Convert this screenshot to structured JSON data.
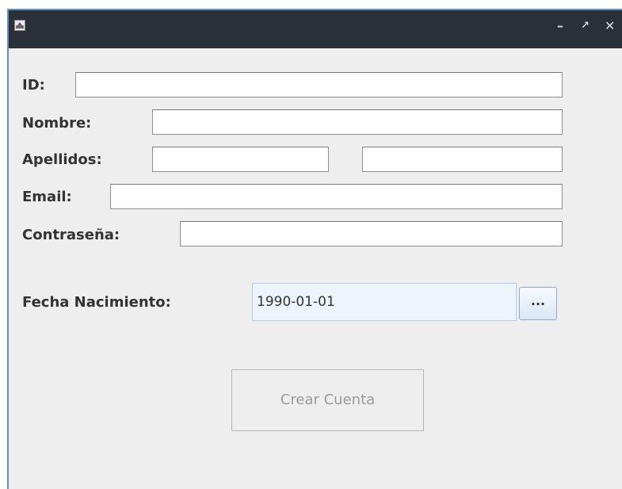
{
  "window": {
    "controls": {
      "minimize": "–",
      "maximize": "↗",
      "close": "✕"
    }
  },
  "form": {
    "id_label": "ID:",
    "id_value": "",
    "nombre_label": "Nombre:",
    "nombre_value": "",
    "apellidos_label": "Apellidos:",
    "apellido1_value": "",
    "apellido2_value": "",
    "email_label": "Email:",
    "email_value": "",
    "password_label": "Contraseña:",
    "password_value": "",
    "fecha_label": "Fecha Nacimiento:",
    "fecha_value": "1990-01-01",
    "date_button_label": "...",
    "create_button_label": "Crear Cuenta"
  },
  "colors": {
    "titlebar": "#2b2f37",
    "accent": "#5b8fd6",
    "panel": "#eeeeee",
    "date_field_bg": "#eef4fb",
    "disabled_text": "#9a9a9a"
  },
  "icons": {
    "app": "app-icon",
    "minimize": "minimize-icon",
    "maximize": "maximize-icon",
    "close": "close-icon"
  }
}
